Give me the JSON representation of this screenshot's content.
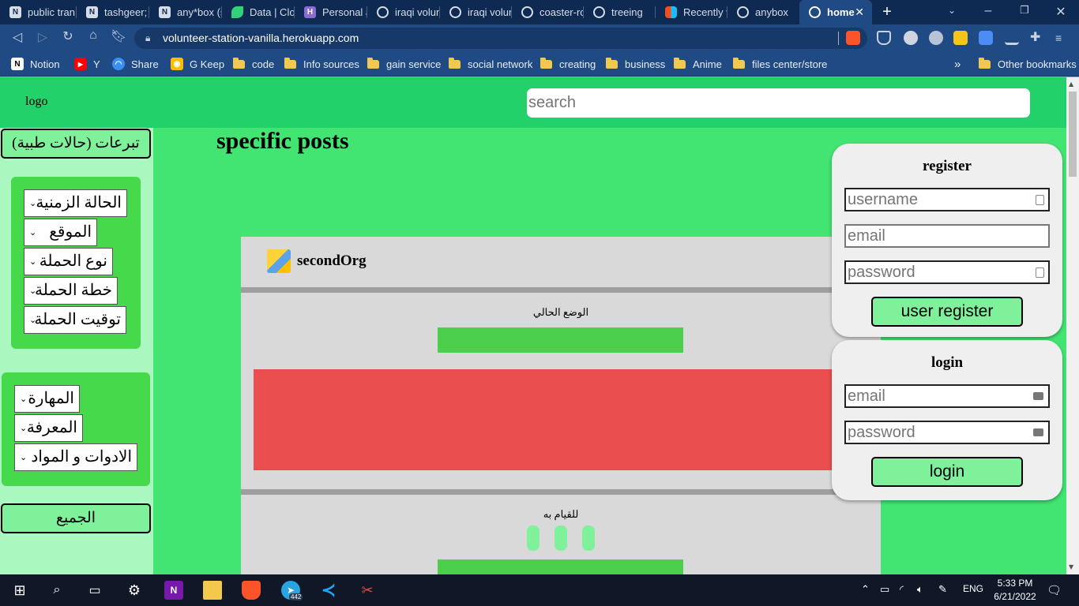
{
  "browser": {
    "tabs": [
      {
        "label": "public tran",
        "icon": "notion-icon"
      },
      {
        "label": "tashgeer;",
        "icon": "notion-icon"
      },
      {
        "label": "any*box (s",
        "icon": "notion-icon"
      },
      {
        "label": "Data | Clo",
        "icon": "leaf-icon"
      },
      {
        "label": "Personal a",
        "icon": "heroku-icon"
      },
      {
        "label": "iraqi volun",
        "icon": "globe-icon"
      },
      {
        "label": "iraqi volun",
        "icon": "globe-icon"
      },
      {
        "label": "coaster-ro",
        "icon": "globe-icon"
      },
      {
        "label": "treeing",
        "icon": "globe-icon"
      },
      {
        "label": "Recently v",
        "icon": "figma-icon"
      },
      {
        "label": "anybox",
        "icon": "globe-icon"
      },
      {
        "label": "home",
        "icon": "globe-icon"
      }
    ],
    "url": "volunteer-station-vanilla.herokuapp.com",
    "bookmarks": [
      {
        "label": "Notion",
        "type": "app"
      },
      {
        "label": "Y",
        "type": "youtube"
      },
      {
        "label": "Share",
        "type": "app"
      },
      {
        "label": "G Keep",
        "type": "keep"
      },
      {
        "label": "code",
        "type": "folder"
      },
      {
        "label": "Info sources",
        "type": "folder"
      },
      {
        "label": "gain service",
        "type": "folder"
      },
      {
        "label": "social network",
        "type": "folder"
      },
      {
        "label": "creating",
        "type": "folder"
      },
      {
        "label": "business",
        "type": "folder"
      },
      {
        "label": "Anime",
        "type": "folder"
      },
      {
        "label": "files center/store",
        "type": "folder"
      }
    ],
    "bookmarks_overflow": "»",
    "other_bookmarks": "Other bookmarks"
  },
  "header": {
    "logo": "logo",
    "search_placeholder": "search"
  },
  "sidebar": {
    "top_button": "تبرعات (حالات طبية)",
    "campaign_filters": [
      "الحالة الزمنية",
      "الموقع",
      "نوع الحملة",
      "خطة الحملة",
      "توقيت الحملة"
    ],
    "skill_filters": [
      "المهارة",
      "المعرفة",
      "الادوات و المواد"
    ],
    "all_button": "الجميع"
  },
  "main": {
    "title": "specific posts",
    "post": {
      "org_name": "secondOrg",
      "status_label": "الوضع الحالي",
      "todo_label": "للقيام به"
    }
  },
  "register": {
    "title": "register",
    "username_placeholder": "username",
    "email_placeholder": "email",
    "password_placeholder": "password",
    "button": "user register"
  },
  "login": {
    "title": "login",
    "email_placeholder": "email",
    "password_placeholder": "password",
    "button": "login"
  },
  "taskbar": {
    "telegram_badge": "442",
    "language": "ENG",
    "time": "5:33 PM",
    "date": "6/21/2022"
  },
  "colors": {
    "page_bg": "#42e472",
    "header_bg": "#22d16a",
    "button_green": "#7ff19b",
    "red_block": "#ea4e4e"
  }
}
